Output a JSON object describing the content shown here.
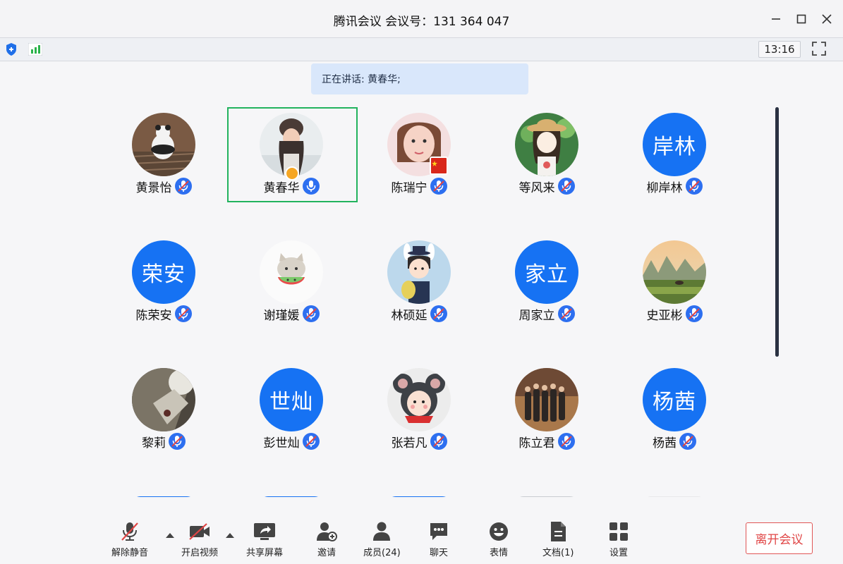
{
  "window": {
    "title": "腾讯会议 会议号：131 364 047"
  },
  "toolbar": {
    "time": "13:16"
  },
  "speaking": {
    "text": "正在讲话: 黄春华;"
  },
  "participants": [
    {
      "name": "黄景怡",
      "avatar_text": "",
      "avatar_type": "photo-panda",
      "mic": "muted"
    },
    {
      "name": "黄春华",
      "avatar_text": "",
      "avatar_type": "photo-woman",
      "mic": "on",
      "host": true,
      "active": true
    },
    {
      "name": "陈瑞宁",
      "avatar_text": "",
      "avatar_type": "photo-girl",
      "mic": "muted",
      "flag": true
    },
    {
      "name": "等风来",
      "avatar_text": "",
      "avatar_type": "cartoon-girl-hat",
      "mic": "muted"
    },
    {
      "name": "柳岸林",
      "avatar_text": "岸林",
      "avatar_type": "text",
      "mic": "muted"
    },
    {
      "name": "陈荣安",
      "avatar_text": "荣安",
      "avatar_type": "text",
      "mic": "muted"
    },
    {
      "name": "谢瑾媛",
      "avatar_text": "",
      "avatar_type": "cartoon-cat",
      "mic": "muted"
    },
    {
      "name": "林硕延",
      "avatar_text": "",
      "avatar_type": "cartoon-boy",
      "mic": "muted"
    },
    {
      "name": "周家立",
      "avatar_text": "家立",
      "avatar_type": "text",
      "mic": "muted"
    },
    {
      "name": "史亚彬",
      "avatar_text": "",
      "avatar_type": "photo-landscape",
      "mic": "muted"
    },
    {
      "name": "黎莉",
      "avatar_text": "",
      "avatar_type": "photo-dark",
      "mic": "muted"
    },
    {
      "name": "彭世灿",
      "avatar_text": "世灿",
      "avatar_type": "text",
      "mic": "muted"
    },
    {
      "name": "张若凡",
      "avatar_text": "",
      "avatar_type": "cartoon-mouse",
      "mic": "muted"
    },
    {
      "name": "陈立君",
      "avatar_text": "",
      "avatar_type": "photo-group",
      "mic": "muted"
    },
    {
      "name": "杨茜",
      "avatar_text": "杨茜",
      "avatar_type": "text",
      "mic": "muted"
    }
  ],
  "bottom": {
    "unmute": "解除静音",
    "video": "开启视频",
    "share": "共享屏幕",
    "invite": "邀请",
    "members": "成员(24)",
    "chat": "聊天",
    "emoji": "表情",
    "docs": "文档(1)",
    "settings": "设置",
    "leave": "离开会议"
  },
  "colors": {
    "accent": "#1672f3",
    "active_border": "#22b35e",
    "leave": "#e04545",
    "mic_muted_slash": "#e04545"
  }
}
